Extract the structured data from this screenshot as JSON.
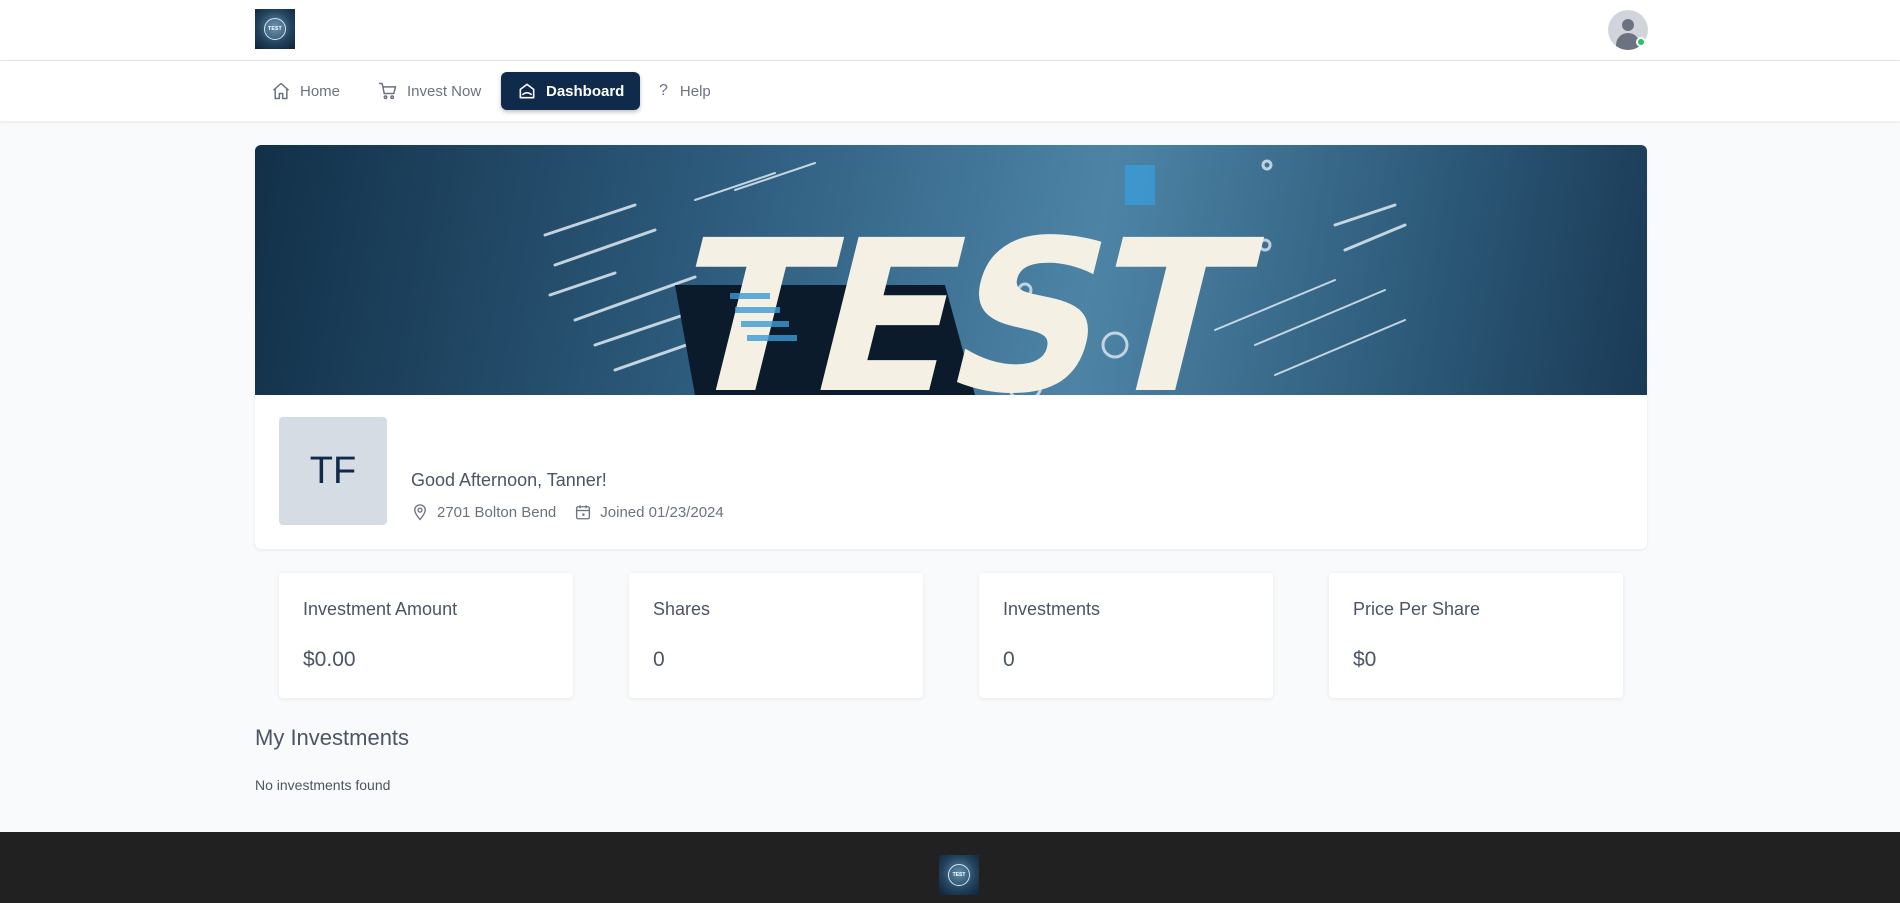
{
  "header": {
    "logo_text": "TEST",
    "avatar_status_color": "#22c55e"
  },
  "nav": {
    "items": [
      {
        "label": "Home",
        "icon": "home-icon",
        "active": false
      },
      {
        "label": "Invest Now",
        "icon": "cart-icon",
        "active": false
      },
      {
        "label": "Dashboard",
        "icon": "dashboard-icon",
        "active": true
      },
      {
        "label": "Help",
        "icon": "question-icon",
        "active": false
      }
    ],
    "active_color": "#0f2a4a"
  },
  "profile": {
    "banner_text": "TEST",
    "initials": "TF",
    "greeting": "Good Afternoon, Tanner!",
    "address": "2701 Bolton Bend",
    "joined": "Joined 01/23/2024"
  },
  "stats": [
    {
      "label": "Investment Amount",
      "value": "$0.00"
    },
    {
      "label": "Shares",
      "value": "0"
    },
    {
      "label": "Investments",
      "value": "0"
    },
    {
      "label": "Price Per Share",
      "value": "$0"
    }
  ],
  "investments": {
    "title": "My Investments",
    "empty_message": "No investments found"
  },
  "footer": {
    "logo_text": "TEST",
    "background": "#212121"
  }
}
